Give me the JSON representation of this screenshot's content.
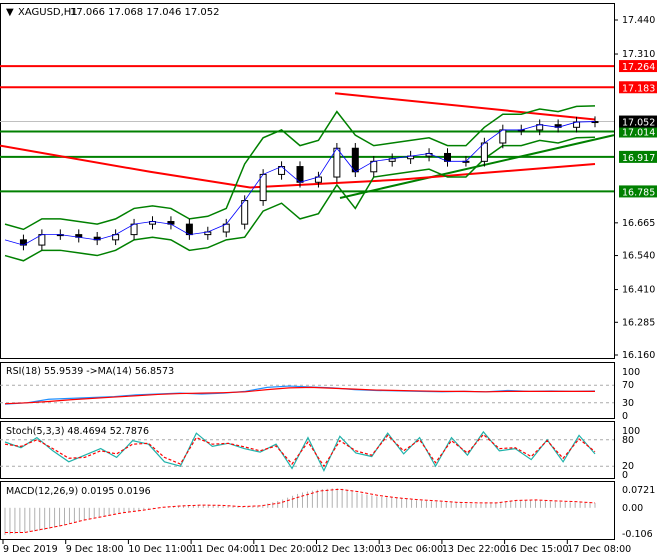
{
  "chart_data": {
    "type": "line",
    "title": "XAGUSD,H1",
    "ohlc": [
      "17.066",
      "17.068",
      "17.046",
      "17.052"
    ],
    "ylim": [
      16.16,
      17.44
    ],
    "y_ticks": [
      "17.440",
      "17.310",
      "16.665",
      "16.540",
      "16.410",
      "16.285",
      "16.160"
    ],
    "levels": [
      {
        "value": 17.264,
        "label": "17.264",
        "color": "#ff0000"
      },
      {
        "value": 17.183,
        "label": "17.183",
        "color": "#ff0000"
      },
      {
        "value": 17.014,
        "label": "17.014",
        "color": "#008000"
      },
      {
        "value": 16.917,
        "label": "16.917",
        "color": "#008000"
      },
      {
        "value": 16.785,
        "label": "16.785",
        "color": "#008000"
      }
    ],
    "current_price": {
      "value": 17.052,
      "label": "17.052",
      "color": "#000000"
    },
    "x_labels": [
      "9 Dec 2019",
      "9 Dec 18:00",
      "10 Dec 11:00",
      "11 Dec 04:00",
      "11 Dec 20:00",
      "12 Dec 13:00",
      "13 Dec 06:00",
      "13 Dec 22:00",
      "16 Dec 15:00",
      "17 Dec 08:00"
    ],
    "close": [
      16.6,
      16.58,
      16.62,
      16.62,
      16.61,
      16.6,
      16.62,
      16.66,
      16.67,
      16.66,
      16.62,
      16.63,
      16.66,
      16.75,
      16.85,
      16.88,
      16.82,
      16.84,
      16.95,
      16.86,
      16.9,
      16.91,
      16.92,
      16.93,
      16.9,
      16.9,
      16.97,
      17.02,
      17.02,
      17.04,
      17.03,
      17.05,
      17.052
    ],
    "rsi": {
      "label": "RSI(18) 55.9539  ->MA(14) 56.8573",
      "ticks": [
        "100",
        "70",
        "30",
        "0"
      ],
      "values": [
        27,
        30,
        38,
        40,
        42,
        44,
        48,
        50,
        52,
        50,
        52,
        56,
        65,
        68,
        66,
        64,
        60,
        58,
        57,
        56,
        55,
        56,
        55,
        58,
        56,
        57,
        56,
        57
      ],
      "ma": [
        28,
        30,
        33,
        37,
        40,
        43,
        46,
        49,
        51,
        52,
        53,
        55,
        60,
        64,
        65,
        63,
        61,
        59,
        58,
        57,
        56,
        56,
        55,
        56,
        56,
        56,
        56,
        56
      ]
    },
    "stoch": {
      "label": "Stoch(5,3,3) 48.4694 52.7876",
      "ticks": [
        "100",
        "80",
        "20",
        "0"
      ],
      "values": [
        75,
        62,
        85,
        55,
        30,
        45,
        60,
        40,
        78,
        70,
        30,
        20,
        95,
        65,
        72,
        60,
        52,
        70,
        15,
        85,
        10,
        88,
        50,
        42,
        95,
        48,
        85,
        20,
        85,
        45,
        98,
        55,
        60,
        35,
        80,
        30,
        90,
        48
      ],
      "signal": [
        70,
        65,
        80,
        60,
        38,
        40,
        55,
        48,
        70,
        72,
        40,
        25,
        85,
        70,
        72,
        64,
        55,
        66,
        25,
        75,
        20,
        78,
        55,
        45,
        90,
        55,
        80,
        28,
        78,
        50,
        92,
        60,
        62,
        42,
        78,
        38,
        82,
        53
      ]
    },
    "macd": {
      "label": "MACD(12,26,9) 0.0195 0.0196",
      "ticks": [
        "0.0721",
        "0.00",
        "-0.106"
      ],
      "hist": [
        -0.11,
        -0.1,
        -0.09,
        -0.07,
        -0.05,
        -0.035,
        -0.02,
        -0.01,
        0.0,
        0.01,
        0.012,
        0.01,
        0.005,
        0.01,
        0.03,
        0.06,
        0.075,
        0.08,
        0.06,
        0.045,
        0.04,
        0.03,
        0.025,
        0.02,
        0.015,
        0.02,
        0.028,
        0.03,
        0.025,
        0.022,
        0.02
      ],
      "signal": [
        -0.1,
        -0.1,
        -0.085,
        -0.07,
        -0.05,
        -0.035,
        -0.02,
        -0.01,
        0.002,
        0.008,
        0.011,
        0.01,
        0.005,
        0.008,
        0.02,
        0.045,
        0.068,
        0.075,
        0.065,
        0.05,
        0.04,
        0.033,
        0.028,
        0.022,
        0.02,
        0.02,
        0.03,
        0.032,
        0.028,
        0.025,
        0.02
      ]
    }
  }
}
